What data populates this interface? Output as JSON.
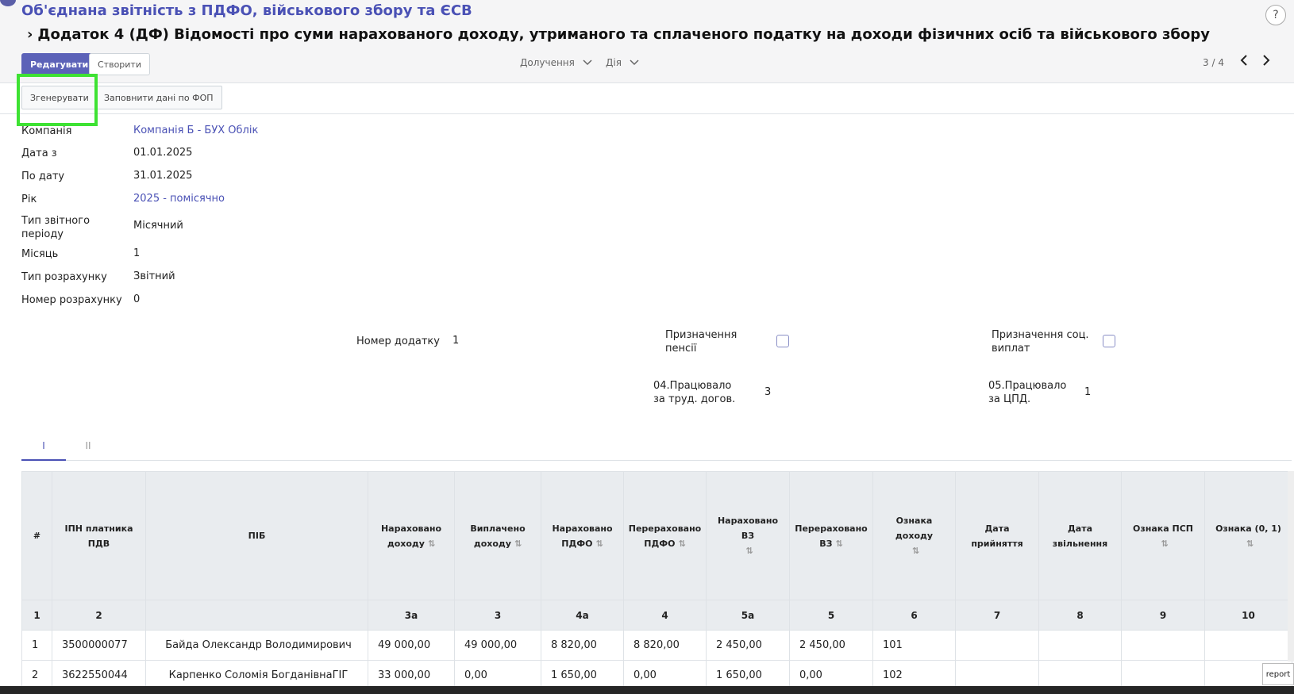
{
  "header": {
    "breadcrumb": "Об'єднана звітність з ПДФО, військового збору та ЄСВ",
    "subtitle": "Додаток 4 (ДФ) Відомості про суми нарахованого доходу, утриманого та сплаченого податку на доходи фізичних осіб та військового збору",
    "help": "?"
  },
  "toolbar": {
    "edit": "Редагувати",
    "create": "Створити",
    "attachments": "Долучення",
    "action": "Дія",
    "pager": "3 / 4"
  },
  "statusbar": {
    "generate": "Згенерувати",
    "fill_fop": "Заповнити дані по ФОП"
  },
  "fields": [
    {
      "label": "Компанія",
      "value": "Компанія Б - БУХ Облік",
      "link": true
    },
    {
      "label": "Дата з",
      "value": "01.01.2025",
      "link": false
    },
    {
      "label": "По дату",
      "value": "31.01.2025",
      "link": false
    },
    {
      "label": "Рік",
      "value": "2025 - помісячно",
      "link": true
    },
    {
      "label": "Тип звітного періоду",
      "value": "Місячний",
      "link": false
    },
    {
      "label": "Місяць",
      "value": "1",
      "link": false
    },
    {
      "label": "Тип розрахунку",
      "value": "Звітний",
      "link": false
    },
    {
      "label": "Номер розрахунку",
      "value": "0",
      "link": false
    }
  ],
  "extra": {
    "appendix_no_label": "Номер додатку",
    "appendix_no": "1",
    "pension_label": "Призначення пенсії",
    "social_label": "Призначення соц. виплат",
    "worked_labor_label": "04.Працювало за труд. догов.",
    "worked_labor": "3",
    "worked_cpd_label": "05.Працювало за ЦПД.",
    "worked_cpd": "1"
  },
  "tabs": [
    "I",
    "II"
  ],
  "table": {
    "headers": [
      "#",
      "ІПН платника ПДВ",
      "ПІБ",
      "Нараховано доходу",
      "Виплачено доходу",
      "Нараховано ПДФО",
      "Перераховано ПДФО",
      "Нараховано ВЗ",
      "Перераховано ВЗ",
      "Ознака доходу",
      "Дата прийняття",
      "Дата звільнення",
      "Ознака ПСП",
      "Ознака (0, 1)"
    ],
    "numbers": [
      "1",
      "2",
      "",
      "3а",
      "3",
      "4а",
      "4",
      "5а",
      "5",
      "6",
      "7",
      "8",
      "9",
      "10"
    ],
    "rows": [
      [
        "1",
        "3500000077",
        "Байда Олександр Володимирович",
        "49 000,00",
        "49 000,00",
        "8 820,00",
        "8 820,00",
        "2 450,00",
        "2 450,00",
        "101",
        "",
        "",
        "",
        ""
      ],
      [
        "2",
        "3622550044",
        "Карпенко Соломія БогданівнаГІГ",
        "33 000,00",
        "0,00",
        "1 650,00",
        "0,00",
        "1 650,00",
        "0,00",
        "102",
        "",
        "",
        "",
        ""
      ]
    ]
  },
  "report_button": "report"
}
